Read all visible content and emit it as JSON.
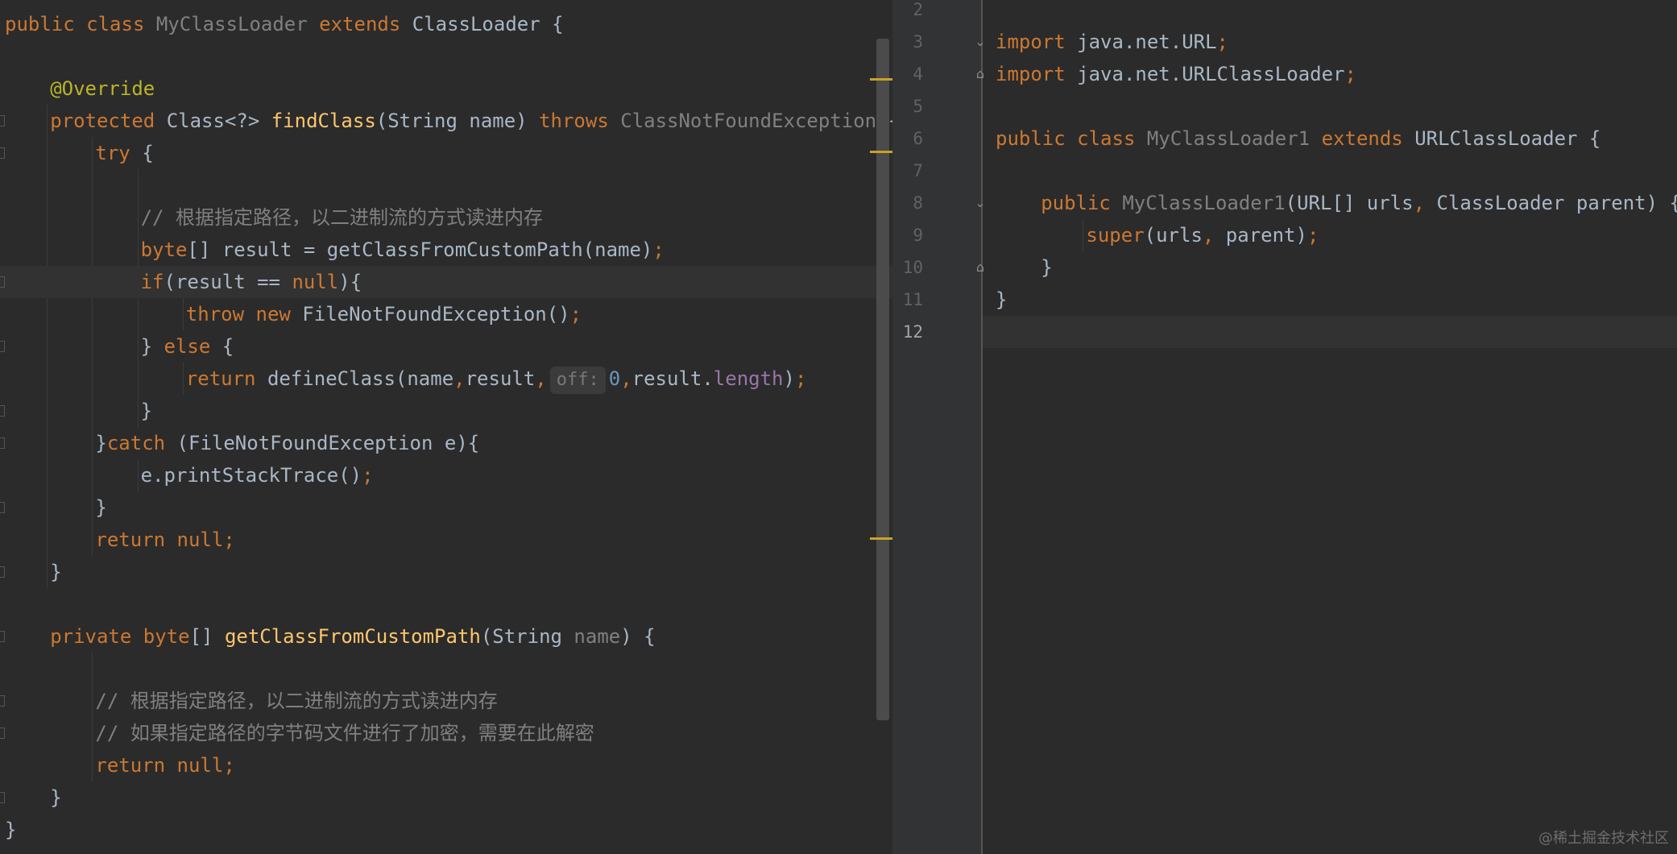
{
  "left_editor": {
    "lines": [
      {
        "segs": [
          [
            "kw",
            "public class "
          ],
          [
            "dim",
            "MyClassLoader "
          ],
          [
            "kw",
            "extends "
          ],
          [
            "cls",
            "ClassLoader {"
          ]
        ]
      },
      {
        "segs": []
      },
      {
        "segs": [
          [
            "ann",
            "@Override"
          ]
        ]
      },
      {
        "segs": [
          [
            "kw",
            "protected "
          ],
          [
            "cls",
            "Class<?> "
          ],
          [
            "fn",
            "findClass"
          ],
          [
            "cls",
            "(String name) "
          ],
          [
            "kw",
            "throws "
          ],
          [
            "dim",
            "ClassNotFoundException "
          ],
          [
            "cls",
            "{"
          ]
        ]
      },
      {
        "segs": [
          [
            "kw",
            "try "
          ],
          [
            "cls",
            "{"
          ]
        ]
      },
      {
        "segs": []
      },
      {
        "segs": [
          [
            "cm",
            "// 根据指定路径，以二进制流的方式读进内存"
          ]
        ]
      },
      {
        "segs": [
          [
            "kw",
            "byte"
          ],
          [
            "cls",
            "[] result = getClassFromCustomPath(name)"
          ],
          [
            "kw",
            ";"
          ]
        ]
      },
      {
        "segs": [
          [
            "kw",
            "if"
          ],
          [
            "cls",
            "(result == "
          ],
          [
            "kw",
            "null"
          ],
          [
            "cls",
            "){"
          ]
        ]
      },
      {
        "segs": [
          [
            "kw",
            "throw new "
          ],
          [
            "cls",
            "FileNotFoundException()"
          ],
          [
            "kw",
            ";"
          ]
        ]
      },
      {
        "segs": [
          [
            "cls",
            "} "
          ],
          [
            "kw",
            "else "
          ],
          [
            "cls",
            "{"
          ]
        ]
      },
      {
        "segs": [
          [
            "kw",
            "return "
          ],
          [
            "cls",
            "defineClass(name"
          ],
          [
            "kw",
            ","
          ],
          [
            "cls",
            "result"
          ],
          [
            "kw",
            ","
          ],
          [
            "hint",
            "off:"
          ],
          [
            "num",
            "0"
          ],
          [
            "kw",
            ","
          ],
          [
            "cls",
            "result."
          ],
          [
            "fld",
            "length"
          ],
          [
            "cls",
            ")"
          ],
          [
            "kw",
            ";"
          ]
        ]
      },
      {
        "segs": [
          [
            "cls",
            "}"
          ]
        ]
      },
      {
        "segs": [
          [
            "cls",
            "}"
          ],
          [
            "kw",
            "catch "
          ],
          [
            "cls",
            "(FileNotFoundException e){"
          ]
        ]
      },
      {
        "segs": [
          [
            "cls",
            "e.printStackTrace()"
          ],
          [
            "kw",
            ";"
          ]
        ]
      },
      {
        "segs": [
          [
            "cls",
            "}"
          ]
        ]
      },
      {
        "segs": [
          [
            "kw",
            "return null;"
          ]
        ]
      },
      {
        "segs": [
          [
            "cls",
            "}"
          ]
        ]
      },
      {
        "segs": []
      },
      {
        "segs": [
          [
            "kw",
            "private byte"
          ],
          [
            "cls",
            "[] "
          ],
          [
            "fn",
            "getClassFromCustomPath"
          ],
          [
            "cls",
            "(String "
          ],
          [
            "dim",
            "name"
          ],
          [
            "cls",
            ") {"
          ]
        ]
      },
      {
        "segs": []
      },
      {
        "segs": [
          [
            "cm",
            "// 根据指定路径，以二进制流的方式读进内存"
          ]
        ]
      },
      {
        "segs": [
          [
            "cm",
            "// 如果指定路径的字节码文件进行了加密，需要在此解密"
          ]
        ]
      },
      {
        "segs": [
          [
            "kw",
            "return null;"
          ]
        ]
      },
      {
        "segs": [
          [
            "cls",
            "}"
          ]
        ]
      },
      {
        "segs": [
          [
            "cls",
            "}"
          ]
        ]
      }
    ]
  },
  "right_editor": {
    "line_numbers": [
      "2",
      "3",
      "4",
      "5",
      "6",
      "7",
      "8",
      "9",
      "10",
      "11",
      "12"
    ],
    "current_line": "12",
    "lines": [
      {
        "segs": []
      },
      {
        "segs": [
          [
            "kw",
            "import "
          ],
          [
            "cls",
            "java.net.URL"
          ],
          [
            "kw",
            ";"
          ]
        ]
      },
      {
        "segs": [
          [
            "kw",
            "import "
          ],
          [
            "cls",
            "java.net.URLClassLoader"
          ],
          [
            "kw",
            ";"
          ]
        ]
      },
      {
        "segs": []
      },
      {
        "segs": [
          [
            "kw",
            "public class "
          ],
          [
            "dim",
            "MyClassLoader1 "
          ],
          [
            "kw",
            "extends "
          ],
          [
            "cls",
            "URLClassLoader {"
          ]
        ]
      },
      {
        "segs": []
      },
      {
        "segs": [
          [
            "kw",
            "public "
          ],
          [
            "dim",
            "MyClassLoader1"
          ],
          [
            "cls",
            "(URL[] urls"
          ],
          [
            "kw",
            ", "
          ],
          [
            "cls",
            "ClassLoader parent) {"
          ]
        ]
      },
      {
        "segs": [
          [
            "kw",
            "super"
          ],
          [
            "cls",
            "(urls"
          ],
          [
            "kw",
            ", "
          ],
          [
            "cls",
            "parent)"
          ],
          [
            "kw",
            ";"
          ]
        ]
      },
      {
        "segs": [
          [
            "cls",
            "}"
          ]
        ]
      },
      {
        "segs": [
          [
            "cls",
            "}"
          ]
        ]
      },
      {
        "segs": []
      }
    ]
  },
  "watermark": "@稀土掘金技术社区"
}
